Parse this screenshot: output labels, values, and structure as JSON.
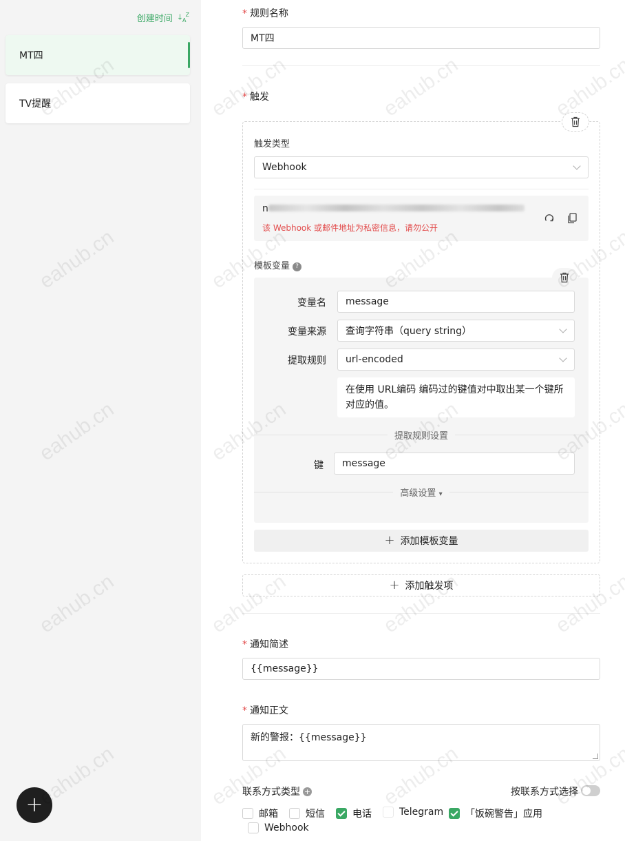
{
  "sidebar": {
    "sort_label": "创建时间",
    "sort_icon": "sort-az-icon",
    "rules": [
      {
        "name": "MT四",
        "active": true
      },
      {
        "name": "TV提醒",
        "active": false
      }
    ],
    "add_icon": "+"
  },
  "form": {
    "rule_name_label": "规则名称",
    "rule_name_value": "MT四",
    "trigger_label": "触发",
    "trigger_type_label": "触发类型",
    "trigger_type_value": "Webhook",
    "webhook_url_prefix": "n",
    "webhook_warning": "该 Webhook 或邮件地址为私密信息，请勿公开",
    "template_vars_label": "模板变量",
    "help_icon": "?",
    "var_name_label": "变量名",
    "var_name_value": "message",
    "var_source_label": "变量来源",
    "var_source_value": "查询字符串（query string）",
    "extract_rule_label": "提取规则",
    "extract_rule_value": "url-encoded",
    "extract_rule_desc": "在使用 URL编码 编码过的键值对中取出某一个键所对应的值。",
    "extract_settings_label": "提取规则设置",
    "key_label": "键",
    "key_value": "message",
    "advanced_label": "高级设置",
    "advanced_caret": "▾",
    "add_template_var_label": "添加模板变量",
    "add_trigger_label": "添加触发项",
    "plus_glyph": "+",
    "notify_summary_label": "通知简述",
    "notify_summary_value": "{{message}}",
    "notify_body_label": "通知正文",
    "notify_body_value": "新的警报：{{message}}",
    "contact_type_label": "联系方式类型",
    "contact_select_label": "按联系方式选择",
    "contact_select_on": false,
    "contact_options": [
      {
        "label": "邮箱",
        "checked": false
      },
      {
        "label": "短信",
        "checked": false
      },
      {
        "label": "电话",
        "checked": true
      },
      {
        "label": "Telegram",
        "checked": false
      },
      {
        "label": "「饭碗警告」应用",
        "checked": true
      },
      {
        "label": "Webhook",
        "checked": false
      }
    ]
  },
  "watermark_text": "eahub.cn",
  "colors": {
    "accent": "#3aa864",
    "required": "#e24b4b"
  }
}
